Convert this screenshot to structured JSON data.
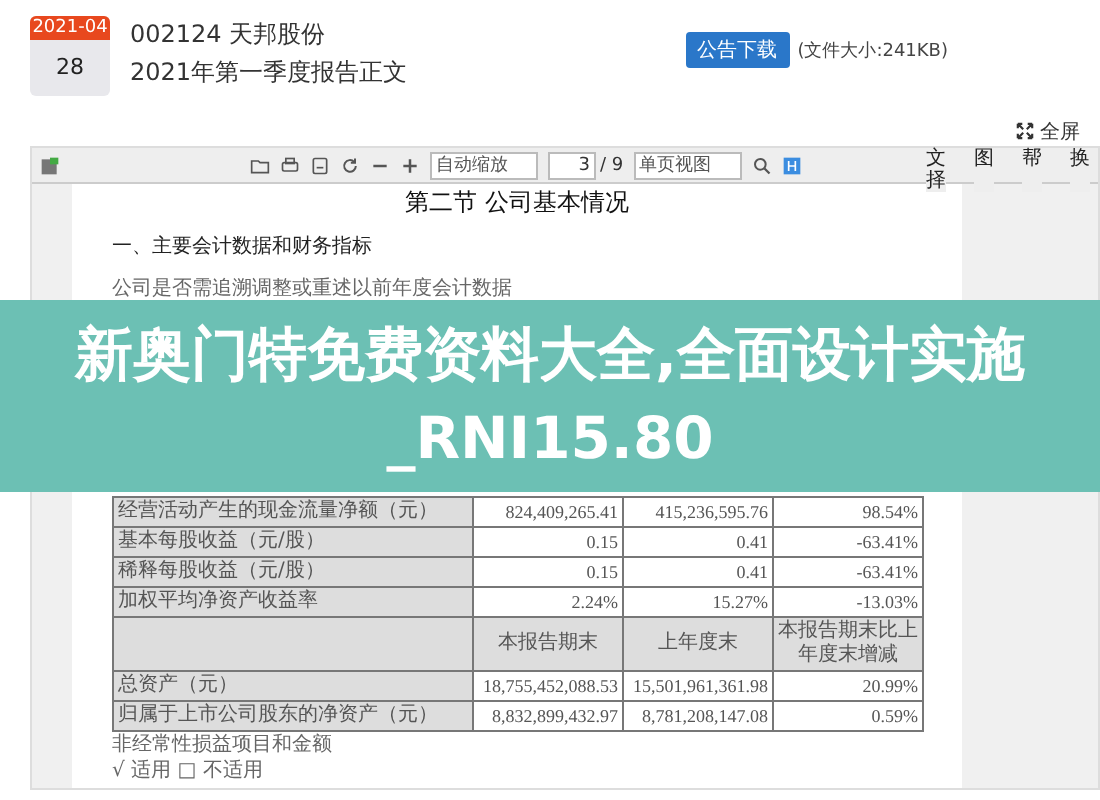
{
  "notice": {
    "date_month": "2021-04",
    "date_day": "28",
    "title_lines": [
      "002124 天邦股份",
      "2021年第一季度报告正文"
    ],
    "download_button": "公告下载",
    "file_size": "(文件大小:241KB)"
  },
  "fullscreen": "全屏",
  "toolbar": {
    "zoom_value": "自动缩放",
    "page": "3",
    "page_total": "/ 9",
    "view_value": "单页视图",
    "side_tabs": [
      "文择",
      "图",
      "帮",
      "换"
    ]
  },
  "document": {
    "heading": "第二节  公司基本情况",
    "section": "一、主要会计数据和财务指标",
    "note": "公司是否需追溯调整或重述以前年度会计数据",
    "rows": [
      {
        "kind": "data",
        "cells": [
          "经营活动产生的现金流量净额（元）",
          "824,409,265.41",
          "415,236,595.76",
          "98.54%"
        ]
      },
      {
        "kind": "data",
        "cells": [
          "基本每股收益（元/股）",
          "0.15",
          "0.41",
          "-63.41%"
        ]
      },
      {
        "kind": "data",
        "cells": [
          "稀释每股收益（元/股）",
          "0.15",
          "0.41",
          "-63.41%"
        ]
      },
      {
        "kind": "data",
        "cells": [
          "加权平均净资产收益率",
          "2.24%",
          "15.27%",
          "-13.03%"
        ]
      },
      {
        "kind": "header",
        "cells": [
          "",
          "本报告期末",
          "上年度末",
          "本报告期末比上年度末增减"
        ]
      },
      {
        "kind": "data",
        "cells": [
          "总资产（元）",
          "18,755,452,088.53",
          "15,501,961,361.98",
          "20.99%"
        ]
      },
      {
        "kind": "data",
        "cells": [
          "归属于上市公司股东的净资产（元）",
          "8,832,899,432.97",
          "8,781,208,147.08",
          "0.59%"
        ]
      }
    ],
    "after": [
      "非经常性损益项目和金额",
      "√ 适用 □ 不适用"
    ]
  },
  "banner": {
    "text": "新奥门特免费资料大全,全面设计实施_RNI15.80"
  }
}
